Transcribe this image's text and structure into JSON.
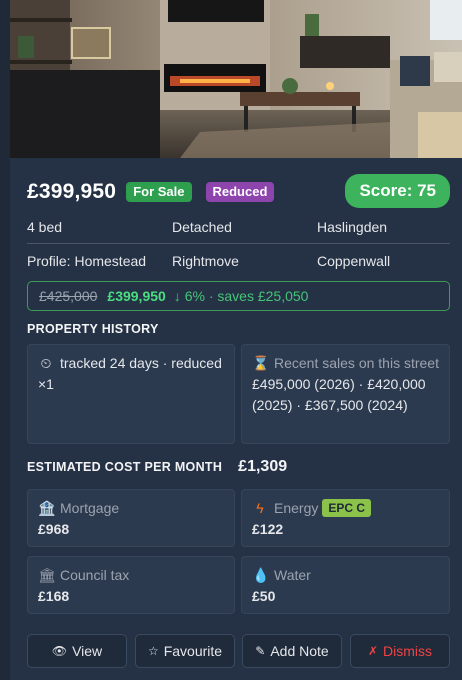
{
  "listing": {
    "price": "£399,950",
    "badge_sale": "For Sale",
    "badge_reduced": "Reduced",
    "score": "Score: 75"
  },
  "facts": {
    "beds": "4 bed",
    "type": "Detached",
    "town": "Haslingden",
    "profile": "Profile: Homestead",
    "source": "Rightmove",
    "area": "Coppenwall"
  },
  "reduction": {
    "old_price": "£425,000",
    "new_price": "£399,950",
    "change": "↓ 6% · saves £25,050"
  },
  "history": {
    "title": "PROPERTY HISTORY",
    "tracked_icon": "clock-icon",
    "tracked": "tracked 24 days · reduced ×1",
    "sales_icon": "hourglass-icon",
    "sales_label": "Recent sales on this street",
    "sales_values": "£495,000 (2026) · £420,000 (2025) · £367,500 (2024)"
  },
  "costs": {
    "title": "ESTIMATED COST PER MONTH",
    "total": "£1,309",
    "mortgage_label": "Mortgage",
    "mortgage_value": "£968",
    "energy_label": "Energy",
    "energy_epc": "EPC C",
    "energy_value": "£122",
    "council_label": "Council tax",
    "council_value": "£168",
    "water_label": "Water",
    "water_value": "£50"
  },
  "actions": {
    "view": "View",
    "favourite": "Favourite",
    "note": "Add Note",
    "dismiss": "Dismiss"
  },
  "colors": {
    "card_bg": "#253245",
    "sale_badge": "#2e9e4f",
    "reduced_badge": "#8e44ad",
    "score": "#3cb35c",
    "accent_green": "#4ade80",
    "dismiss_red": "#ef4444",
    "epc_badge": "#8bc34a"
  }
}
